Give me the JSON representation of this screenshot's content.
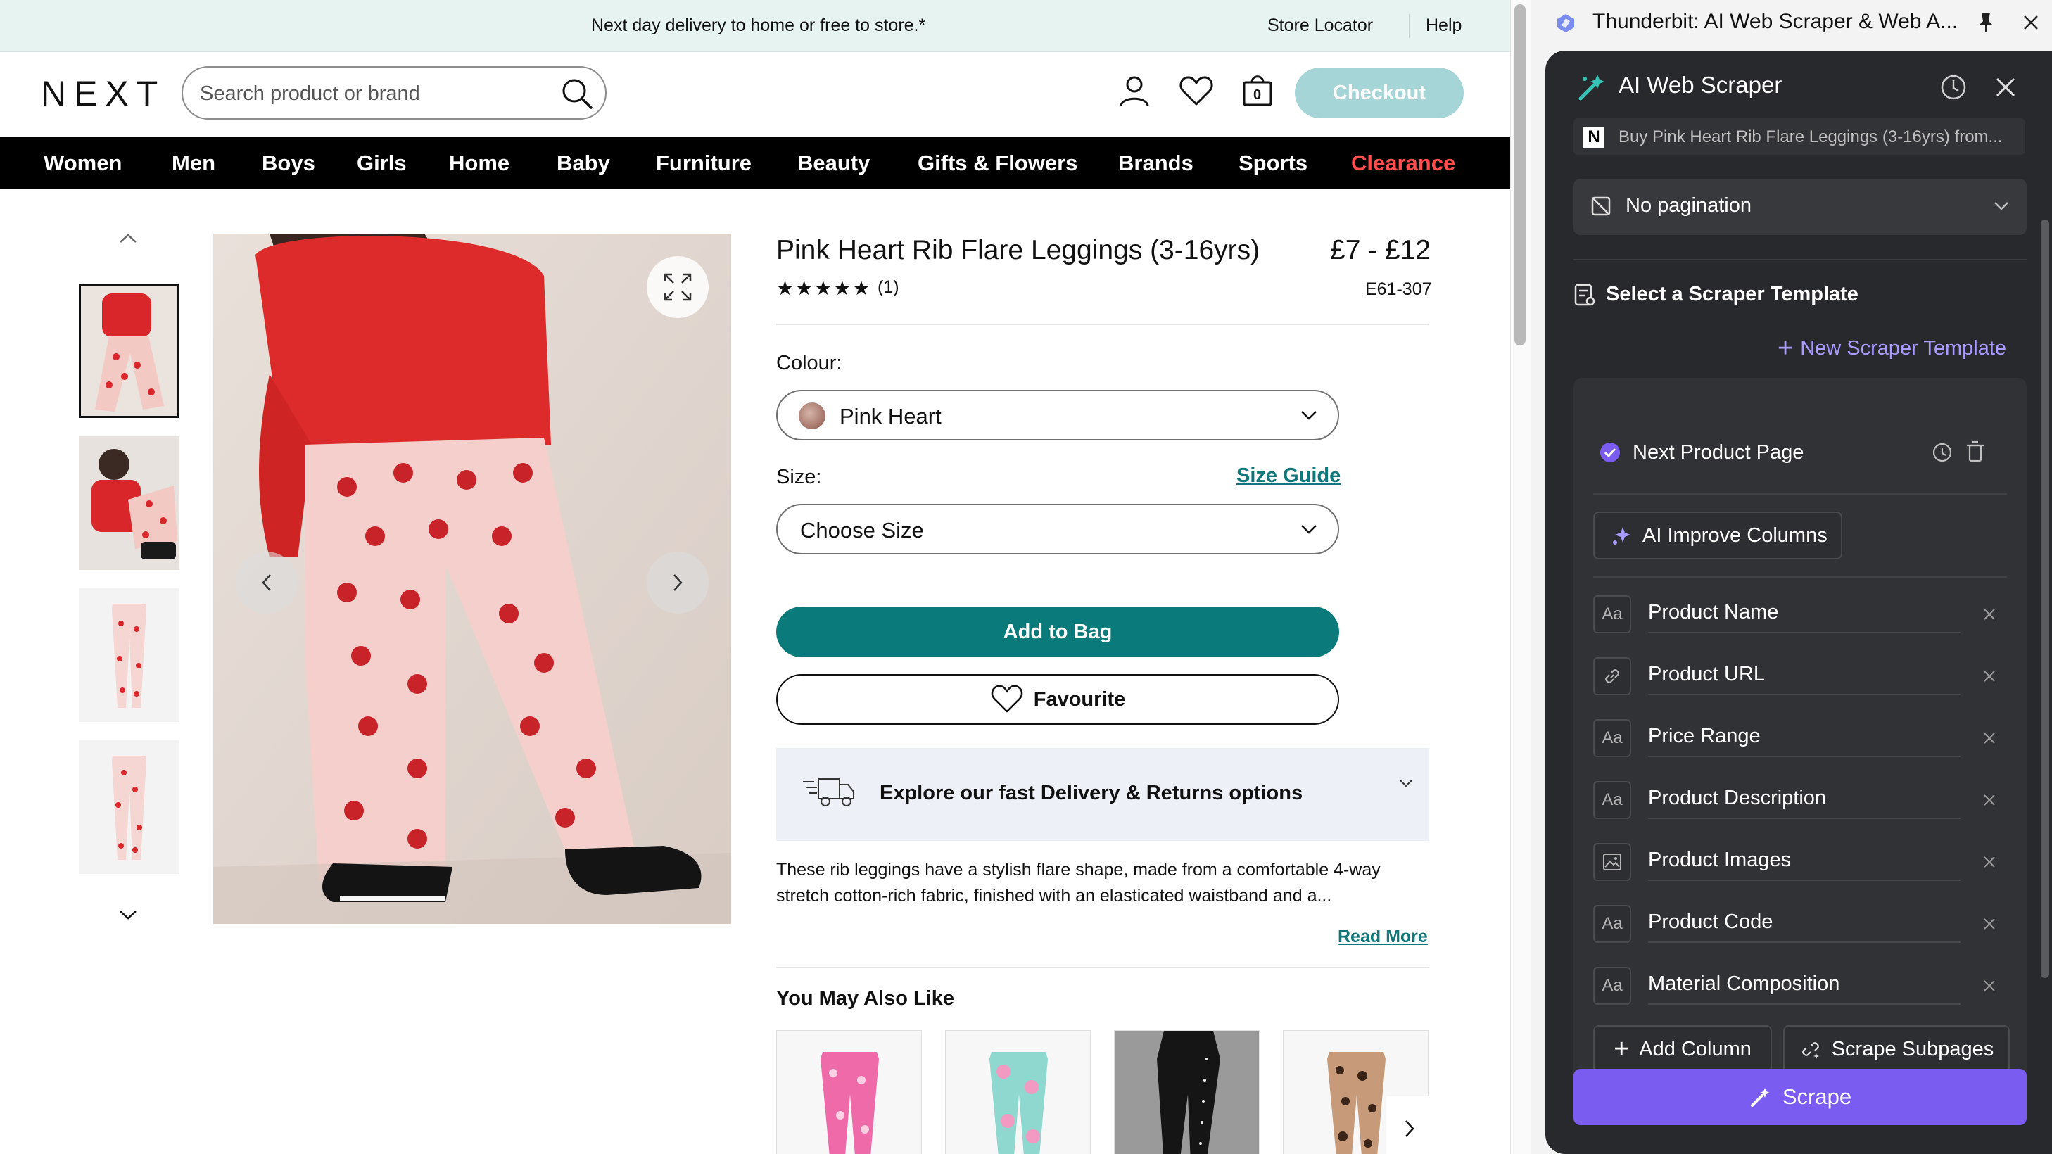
{
  "promo": {
    "message": "Next day delivery to home or free to store.*",
    "store_locator": "Store Locator",
    "help": "Help"
  },
  "header": {
    "logo": "NEXT",
    "search_placeholder": "Search product or brand",
    "bag_count": "0",
    "checkout_label": "Checkout"
  },
  "nav": {
    "items": [
      "Women",
      "Men",
      "Boys",
      "Girls",
      "Home",
      "Baby",
      "Furniture",
      "Beauty",
      "Gifts & Flowers",
      "Brands",
      "Sports",
      "Clearance"
    ],
    "highlight_color": "#ff4c4c"
  },
  "product": {
    "title": "Pink Heart Rib Flare Leggings (3-16yrs)",
    "price": "£7 - £12",
    "rating_stars": "★★★★★",
    "rating": 5,
    "review_count": "(1)",
    "code": "E61-307",
    "colour_label": "Colour:",
    "colour_value": "Pink Heart",
    "size_label": "Size:",
    "size_guide": "Size Guide",
    "size_value": "Choose Size",
    "add_to_bag": "Add to Bag",
    "favourite": "Favourite",
    "delivery_text": "Explore our fast Delivery & Returns options",
    "description": "These rib leggings have a stylish flare shape, made from a comfortable 4-way stretch cotton-rich fabric, finished with an elasticated waistband and a...",
    "read_more": "Read More",
    "also_like": "You May Also Like"
  },
  "extension": {
    "window_title": "Thunderbit: AI Web Scraper & Web A...",
    "panel_title": "AI Web Scraper",
    "page_url_text": "Buy Pink Heart Rib Flare Leggings (3-16yrs) from...",
    "pagination": "No pagination",
    "select_template": "Select a Scraper Template",
    "new_template": "New Scraper Template",
    "template_name": "Next Product Page",
    "ai_improve": "AI Improve Columns",
    "columns": [
      {
        "name": "Product Name",
        "icon": "text-type-icon"
      },
      {
        "name": "Product URL",
        "icon": "link-icon"
      },
      {
        "name": "Price Range",
        "icon": "text-type-icon"
      },
      {
        "name": "Product Description",
        "icon": "text-type-icon"
      },
      {
        "name": "Product Images",
        "icon": "image-icon"
      },
      {
        "name": "Product Code",
        "icon": "text-type-icon"
      },
      {
        "name": "Material Composition",
        "icon": "text-type-icon"
      }
    ],
    "text_icon_glyph": "Aa",
    "add_column": "Add Column",
    "scrape_subpages": "Scrape Subpages",
    "scrape": "Scrape",
    "accent_color": "#7b5cf0"
  }
}
